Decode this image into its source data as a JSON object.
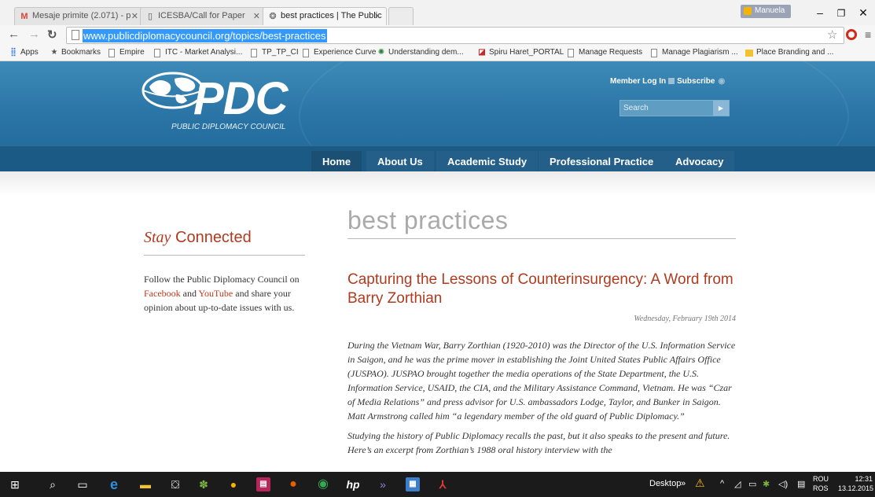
{
  "browser": {
    "tabs": [
      {
        "label": "Mesaje primite (2.071) - p",
        "icon": "gmail-icon",
        "color": "#db4437"
      },
      {
        "label": "ICESBA/Call for Paper",
        "icon": "page-icon"
      },
      {
        "label": "best practices | The Public",
        "icon": "pdc-favicon",
        "active": true
      }
    ],
    "profile_name": "Manuela",
    "window_controls": {
      "minimize": "–",
      "maximize": "❐",
      "close": "✕"
    },
    "url": "www.publicdiplomacycouncil.org/topics/best-practices",
    "bookmarks": [
      {
        "label": "Apps",
        "icon": "apps-grid-icon"
      },
      {
        "label": "Bookmarks",
        "icon": "star-icon"
      },
      {
        "label": "Empire",
        "icon": "page-icon"
      },
      {
        "label": "ITC - Market Analysi...",
        "icon": "page-icon"
      },
      {
        "label": "TP_TP_CI",
        "icon": "page-icon"
      },
      {
        "label": "Experience Curve",
        "icon": "page-icon"
      },
      {
        "label": "Understanding dem...",
        "icon": "globe-icon"
      },
      {
        "label": "Spiru Haret_PORTAL",
        "icon": "portal-icon"
      },
      {
        "label": "Manage Requests",
        "icon": "page-icon"
      },
      {
        "label": "Manage Plagiarism ...",
        "icon": "page-icon"
      },
      {
        "label": "Place Branding and ...",
        "icon": "folder-icon"
      }
    ]
  },
  "site": {
    "logo_text": "PDC",
    "tagline": "PUBLIC DIPLOMACY COUNCIL",
    "member_login": "Member Log In",
    "subscribe": "Subscribe",
    "search_placeholder": "Search",
    "nav": [
      "Home",
      "About Us",
      "Academic Study",
      "Professional Practice",
      "Advocacy"
    ],
    "brand_colors": {
      "header": "#2b76a7",
      "nav": "#1c5a86",
      "accent": "#b13a1f"
    }
  },
  "sidebar": {
    "heading_italic": "Stay",
    "heading_rest": "Connected",
    "text_1": "Follow the Public Diplomacy Council on ",
    "link_facebook": "Facebook",
    "text_and": " and ",
    "link_youtube": "YouTube",
    "text_2": " and share your opinion about up-to-date issues with us."
  },
  "main": {
    "page_title": "best practices",
    "post_title": "Capturing the Lessons of Counterinsurgency: A Word from Barry Zorthian",
    "post_date": "Wednesday, February 19th 2014",
    "paragraph_1": "During the Vietnam War, Barry Zorthian (1920-2010) was the Director of the U.S. Information Service in Saigon, and he was the prime mover in establishing the Joint United States Public Affairs Office (JUSPAO).  JUSPAO brought together the media operations of the State Department, the U.S. Information Service, USAID, the CIA, and the Military Assistance Command, Vietnam.  He was “Czar of Media Relations” and press advisor for U.S. ambassadors Lodge, Taylor, and Bunker in Saigon.  Matt Armstrong called him “a legendary member of the old guard of Public Diplomacy.”",
    "paragraph_2": "Studying the history of Public Diplomacy recalls the past, but it also speaks to the present and future.  Here’s an excerpt from Zorthian’s 1988 oral history interview with the"
  },
  "taskbar": {
    "desktop_label": "Desktop",
    "lang_1": "ROU",
    "lang_2": "ROS",
    "time": "12:31",
    "date": "13.12.2015"
  }
}
